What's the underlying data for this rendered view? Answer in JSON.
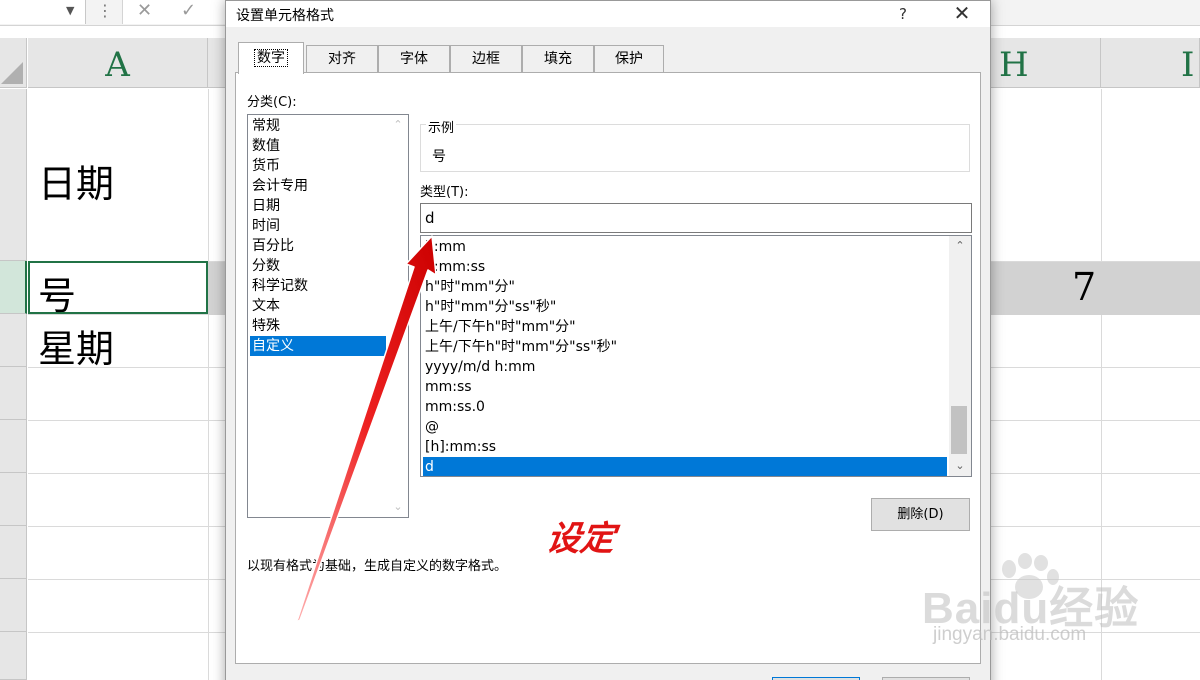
{
  "excel": {
    "columns": [
      {
        "letter": "A"
      },
      {
        "letter": "H"
      },
      {
        "letter": "I"
      }
    ],
    "cells": {
      "a_date": "日期",
      "a_day": "号",
      "a_weekday": "星期",
      "h_day_value": "7"
    }
  },
  "dialog": {
    "title": "设置单元格格式",
    "help_label": "?",
    "close_label": "✕",
    "tabs": [
      {
        "label": "数字"
      },
      {
        "label": "对齐"
      },
      {
        "label": "字体"
      },
      {
        "label": "边框"
      },
      {
        "label": "填充"
      },
      {
        "label": "保护"
      }
    ],
    "active_tab": "数字",
    "category_label": "分类(C):",
    "categories": [
      {
        "label": "常规"
      },
      {
        "label": "数值"
      },
      {
        "label": "货币"
      },
      {
        "label": "会计专用"
      },
      {
        "label": "日期"
      },
      {
        "label": "时间"
      },
      {
        "label": "百分比"
      },
      {
        "label": "分数"
      },
      {
        "label": "科学记数"
      },
      {
        "label": "文本"
      },
      {
        "label": "特殊"
      },
      {
        "label": "自定义"
      }
    ],
    "selected_category": "自定义",
    "sample_legend": "示例",
    "sample_value": "号",
    "type_label": "类型(T):",
    "type_value": "d",
    "formats": [
      {
        "label": "h:mm"
      },
      {
        "label": "h:mm:ss"
      },
      {
        "label": "h\"时\"mm\"分\""
      },
      {
        "label": "h\"时\"mm\"分\"ss\"秒\""
      },
      {
        "label": "上午/下午h\"时\"mm\"分\""
      },
      {
        "label": "上午/下午h\"时\"mm\"分\"ss\"秒\""
      },
      {
        "label": "yyyy/m/d h:mm"
      },
      {
        "label": "mm:ss"
      },
      {
        "label": "mm:ss.0"
      },
      {
        "label": "@"
      },
      {
        "label": "[h]:mm:ss"
      },
      {
        "label": "d"
      }
    ],
    "selected_format": "d",
    "delete_button": "删除(D)",
    "description": "以现有格式为基础，生成自定义的数字格式。"
  },
  "annotation": {
    "text": "设定",
    "color": "#e11414"
  },
  "watermark": {
    "logo": "Baidu经验",
    "url": "jingyan.baidu.com"
  },
  "colors": {
    "excel_green": "#217346",
    "selection_blue": "#0078d7"
  }
}
